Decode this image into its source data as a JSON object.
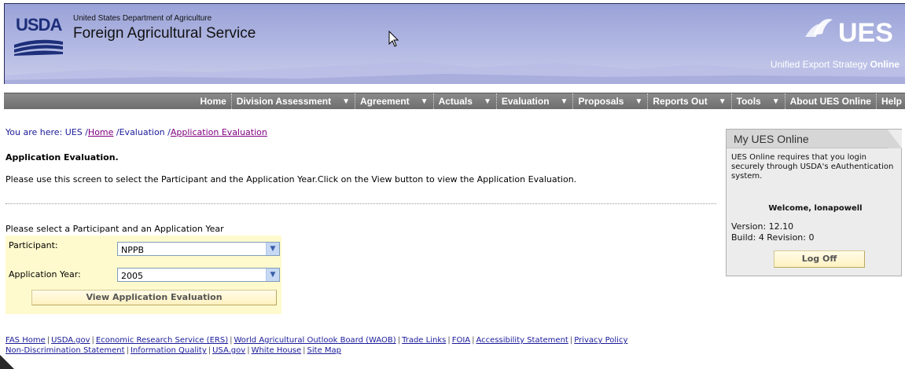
{
  "header": {
    "usda_logo_text": "USDA",
    "department": "United States Department of Agriculture",
    "agency": "Foreign Agricultural Service",
    "ues_logo_text": "UES",
    "tagline_main": "Unified Export Strategy",
    "tagline_bold": "Online"
  },
  "nav": {
    "items": [
      {
        "label": "Home",
        "has_menu": false
      },
      {
        "label": "Division Assessment",
        "has_menu": true
      },
      {
        "label": "Agreement",
        "has_menu": true
      },
      {
        "label": "Actuals",
        "has_menu": true
      },
      {
        "label": "Evaluation",
        "has_menu": true
      },
      {
        "label": "Proposals",
        "has_menu": true
      },
      {
        "label": "Reports Out",
        "has_menu": true
      },
      {
        "label": "Tools",
        "has_menu": true
      },
      {
        "label": "About UES Online",
        "has_menu": false
      },
      {
        "label": "Help",
        "has_menu": false
      }
    ]
  },
  "breadcrumb": {
    "prefix": "You are here: UES /",
    "home": "Home",
    "middle": " /Evaluation /",
    "current": "Application Evaluation"
  },
  "main": {
    "title": "Application Evaluation.",
    "instructions": "Please use this screen to select the Participant and the Application Year.Click on the View button to view the Application Evaluation.",
    "select_prompt": "Please select a Participant and an Application Year",
    "participant_label": "Participant:",
    "participant_value": "NPPB",
    "year_label": "Application Year:",
    "year_value": "2005",
    "view_button": "View Application Evaluation"
  },
  "panel": {
    "title": "My UES Online",
    "message": "UES Online requires that you login securely through USDA's eAuthentication system.",
    "welcome": "Welcome, lonapowell",
    "version": "Version: 12.10",
    "build": "Build: 4 Revision: 0",
    "logoff_button": "Log Off"
  },
  "footer": {
    "line1": [
      "FAS Home",
      "USDA.gov",
      "Economic Research Service (ERS)",
      "World Agricultural Outlook Board (WAOB)",
      "Trade Links",
      "FOIA",
      "Accessibility Statement",
      "Privacy Policy"
    ],
    "line2": [
      "Non-Discrimination Statement",
      "Information Quality",
      "USA.gov",
      "White House",
      "Site Map"
    ]
  },
  "colors": {
    "banner": "#aab1de",
    "navbar": "#7a7a7a",
    "link": "#1a1a9a",
    "visited_link": "#800080",
    "form_bg": "#fffacd"
  }
}
